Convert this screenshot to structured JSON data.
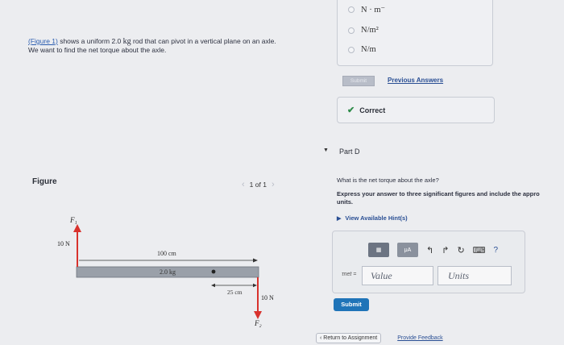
{
  "intro": {
    "link_text": "(Figure 1)",
    "line1_rest": " shows a uniform 2.0 ",
    "unit_kg": "kg",
    "line1_end": " rod that can pivot in a vertical plane on an axle.",
    "line2": "We want to find the net torque about the axle."
  },
  "figure": {
    "title": "Figure",
    "pager": "1 of 1",
    "labels": {
      "f1": "F₁",
      "f2": "F₂",
      "force_left": "10 N",
      "force_right": "10 N",
      "length": "100 cm",
      "mass": "2.0 kg",
      "offset": "25 cm"
    }
  },
  "options": [
    {
      "label": "N · m⁻"
    },
    {
      "label": "N/m²"
    },
    {
      "label": "N/m"
    }
  ],
  "part_c": {
    "submit_label": "Submit",
    "previous_answers": "Previous Answers",
    "feedback": "Correct"
  },
  "part_d": {
    "label": "Part D",
    "question": "What is the net torque about the axle?",
    "instruction_line1": "Express your answer to three significant figures and include the appro",
    "instruction_line2": "units.",
    "hints": "View Available Hint(s)",
    "toolbar": {
      "mu": "μA"
    },
    "input_label": "τnet =",
    "value_placeholder": "Value",
    "units_placeholder": "Units",
    "submit": "Submit"
  },
  "footer": {
    "return": "‹ Return to Assignment",
    "feedback": "Provide Feedback"
  }
}
